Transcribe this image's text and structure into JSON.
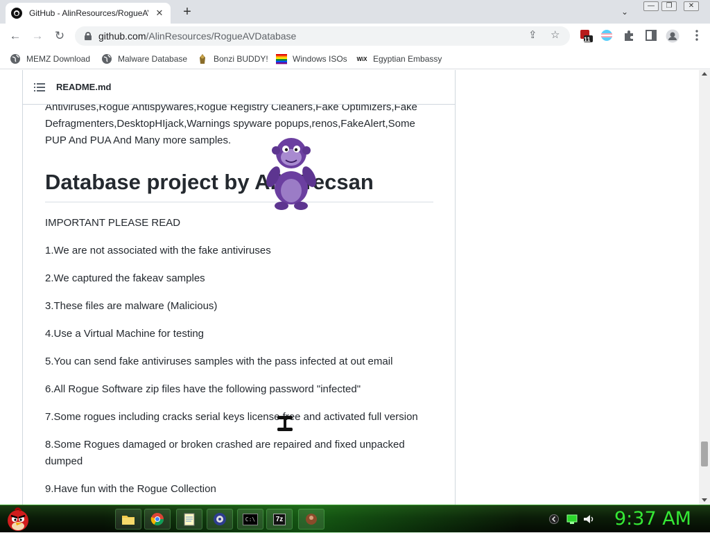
{
  "browser": {
    "tab": {
      "title": "GitHub - AlinResources/RogueAV",
      "close": "✕"
    },
    "new_tab": "+",
    "tab_search": "⌄",
    "window_controls": {
      "minimize": "—",
      "restore": "❐",
      "close": "✕"
    },
    "url": {
      "host": "github.com",
      "path": "/AlinResources/RogueAVDatabase"
    },
    "extension_badge": "11"
  },
  "bookmarks": [
    {
      "label": "MEMZ Download",
      "icon": "globe-icon"
    },
    {
      "label": "Malware Database",
      "icon": "globe-icon"
    },
    {
      "label": "Bonzi BUDDY!",
      "icon": "bonzi-icon"
    },
    {
      "label": "Windows ISOs",
      "icon": "rainbow-flag-icon"
    },
    {
      "label": "Egyptian Embassy",
      "icon": "wix-icon",
      "icon_text": "WiX"
    }
  ],
  "readme": {
    "filename": "README.md",
    "intro": "Antiviruses,Rogue Antispywares,Rogue Registry Cleaners,Fake Optimizers,Fake Defragmenters,DesktopHIjack,Warnings spyware popups,renos,FakeAlert,Some PUP And PUA And Many more samples.",
    "heading": "Database project by Alin Tecsan",
    "notice": "IMPORTANT PLEASE READ",
    "items": [
      "1.We are not associated with the fake antiviruses",
      "2.We captured the fakeav samples",
      "3.These files are malware (Malicious)",
      "4.Use a Virtual Machine for testing",
      "5.You can send fake antiviruses samples with the pass infected at out email",
      "6.All Rogue Software zip files have the following password \"infected\"",
      "7.Some rogues including cracks serial keys license free and activated full version",
      "8.Some Rogues damaged or broken crashed are repaired and fixed unpacked dumped",
      "9.Have fun with the Rogue Collection"
    ]
  },
  "taskbar": {
    "clock": "9:37 AM",
    "apps": [
      "folder-icon",
      "chrome-icon",
      "notepad-icon",
      "media-player-icon",
      "cmd-icon",
      "7zip-icon",
      "bonzi-app-icon"
    ],
    "cmd_label": "C:\\",
    "zip_label": "7z",
    "accent": "#35e835"
  }
}
